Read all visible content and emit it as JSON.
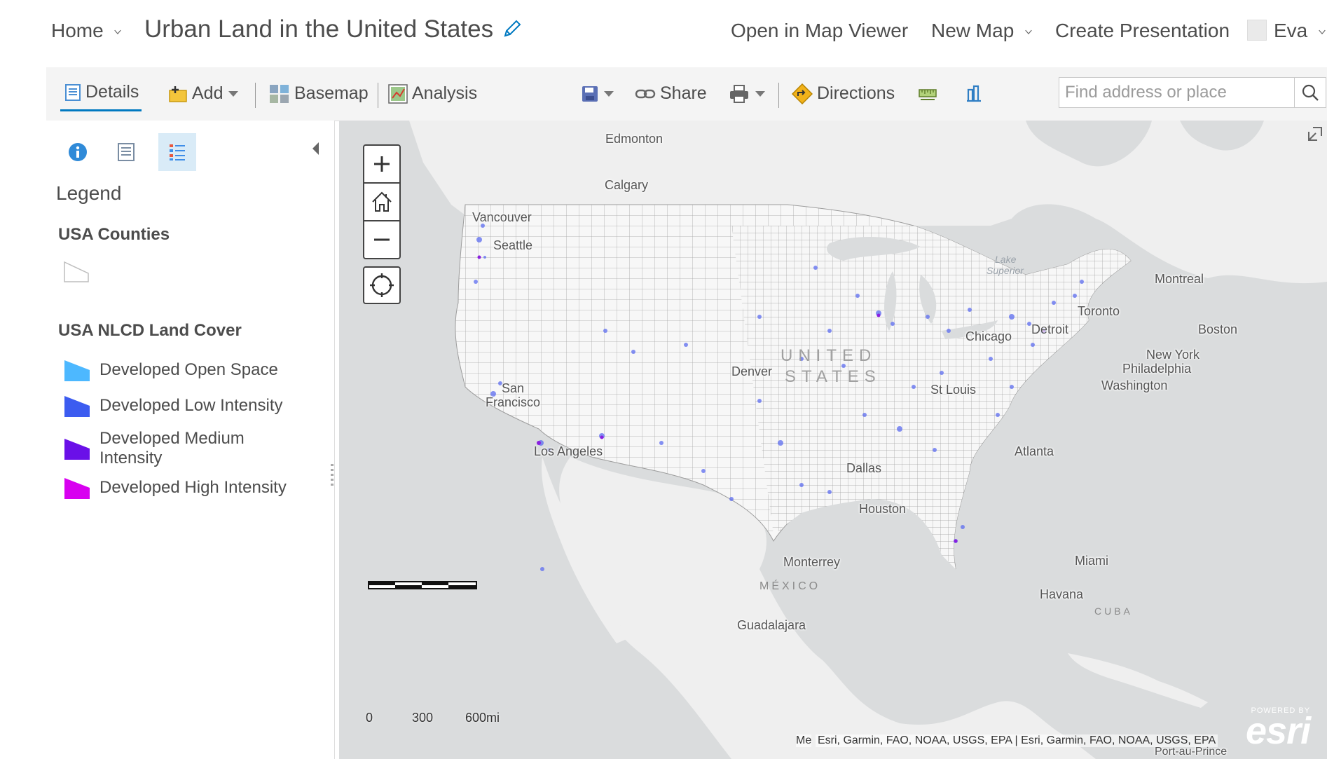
{
  "header": {
    "home_label": "Home",
    "title": "Urban Land in the United States",
    "open_in_map_viewer": "Open in Map Viewer",
    "new_map": "New Map",
    "create_presentation": "Create Presentation",
    "user_name": "Eva"
  },
  "toolbar": {
    "details": "Details",
    "add": "Add",
    "basemap": "Basemap",
    "analysis": "Analysis",
    "share": "Share",
    "directions": "Directions",
    "search_placeholder": "Find address or place"
  },
  "panel": {
    "legend_title": "Legend",
    "layers": [
      {
        "title": "USA Counties"
      },
      {
        "title": "USA NLCD Land Cover",
        "items": [
          {
            "label": "Developed Open Space",
            "color": "#4db8ff"
          },
          {
            "label": "Developed Low Intensity",
            "color": "#3c5cf0"
          },
          {
            "label": "Developed Medium Intensity",
            "color": "#6a10e8"
          },
          {
            "label": "Developed High Intensity",
            "color": "#d800f0"
          }
        ]
      }
    ]
  },
  "map": {
    "cities": {
      "edmonton": "Edmonton",
      "calgary": "Calgary",
      "vancouver": "Vancouver",
      "seattle": "Seattle",
      "montreal": "Montreal",
      "toronto": "Toronto",
      "chicago": "Chicago",
      "detroit": "Detroit",
      "boston": "Boston",
      "new_york": "New York",
      "philadelphia": "Philadelphia",
      "washington": "Washington",
      "denver": "Denver",
      "st_louis": "St Louis",
      "san": "San",
      "francisco": "Francisco",
      "los_angeles": "Los Angeles",
      "atlanta": "Atlanta",
      "dallas": "Dallas",
      "houston": "Houston",
      "monterrey": "Monterrey",
      "miami": "Miami",
      "havana": "Havana",
      "guadalajara": "Guadalajara",
      "port_au_prince": "Port-au-Prince"
    },
    "water": {
      "lake_1": "Lake",
      "lake_2": "Superior"
    },
    "countries": {
      "us_line1": "UNITED",
      "us_line2": "STATES",
      "mexico": "MÉXICO",
      "cuba": "CUBA"
    },
    "scale": {
      "zero": "0",
      "mid": "300",
      "end": "600mi"
    },
    "attribution": "Esri, Garmin, FAO, NOAA, USGS, EPA | Esri, Garmin, FAO, NOAA, USGS, EPA",
    "attribution_prefix": "Me",
    "esri_powered": "POWERED BY",
    "esri_logo": "esri"
  }
}
